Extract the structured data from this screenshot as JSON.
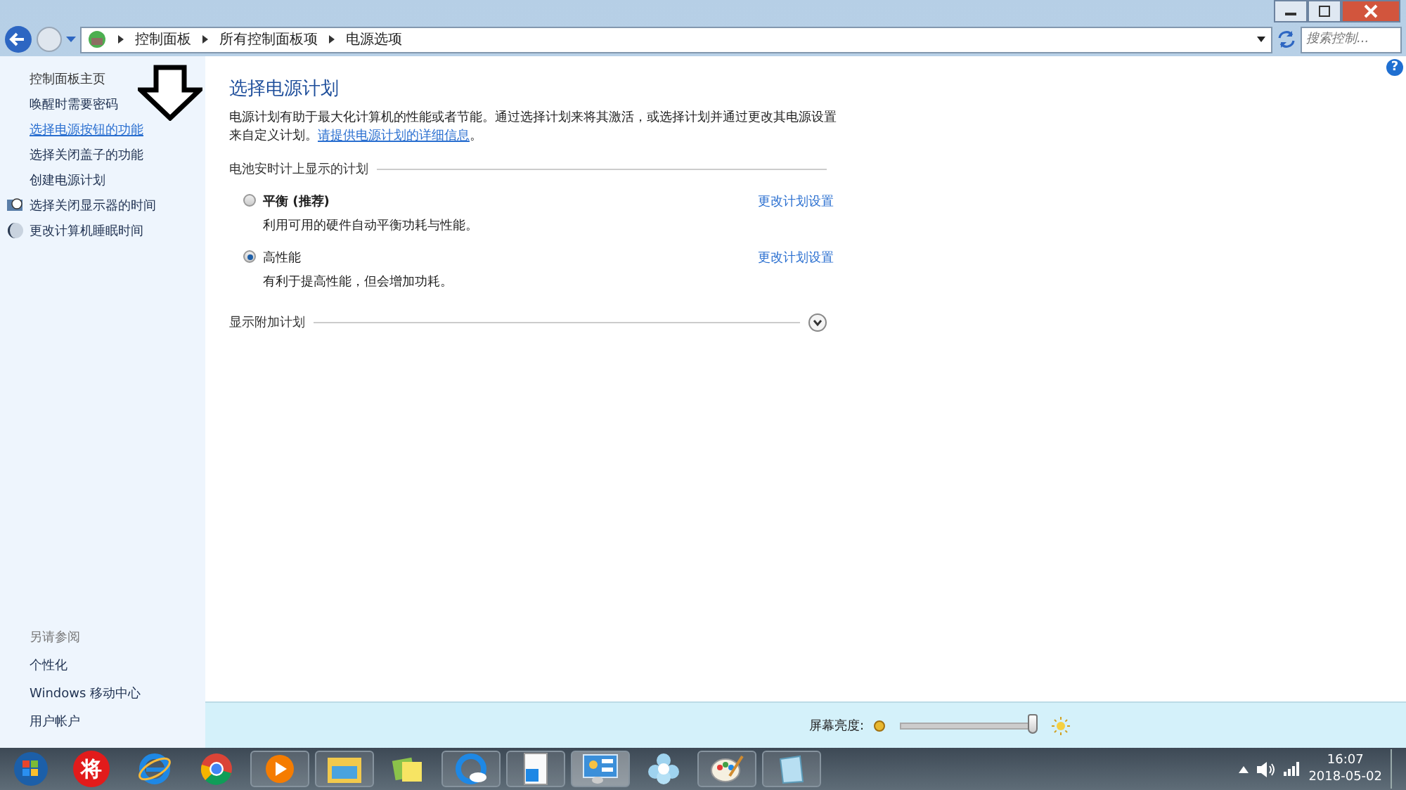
{
  "address_bar": {
    "crumbs": [
      "控制面板",
      "所有控制面板项",
      "电源选项"
    ]
  },
  "search": {
    "placeholder": "搜索控制..."
  },
  "help": "?",
  "sidebar": {
    "items": [
      {
        "label": "控制面板主页",
        "kind": "plain"
      },
      {
        "label": "唤醒时需要密码",
        "kind": "link"
      },
      {
        "label": "选择电源按钮的功能",
        "kind": "hover"
      },
      {
        "label": "选择关闭盖子的功能",
        "kind": "link"
      },
      {
        "label": "创建电源计划",
        "kind": "link"
      },
      {
        "label": "选择关闭显示器的时间",
        "kind": "monitor"
      },
      {
        "label": "更改计算机睡眠时间",
        "kind": "moon"
      }
    ],
    "see_also": {
      "title": "另请参阅",
      "items": [
        "个性化",
        "Windows 移动中心",
        "用户帐户"
      ]
    }
  },
  "main": {
    "title": "选择电源计划",
    "description": "电源计划有助于最大化计算机的性能或者节能。通过选择计划来将其激活，或选择计划并通过更改其电源设置来自定义计划。",
    "link": "请提供电源计划的详细信息",
    "after_link": "。",
    "group_title": "电池安时计上显示的计划",
    "plans": [
      {
        "name": "平衡",
        "note": "(推荐)",
        "description": "利用可用的硬件自动平衡功耗与性能。",
        "action": "更改计划设置",
        "selected": false
      },
      {
        "name": "高性能",
        "description": "有利于提高性能，但会增加功耗。",
        "action": "更改计划设置",
        "selected": true
      }
    ],
    "more_plans": {
      "label": "显示附加计划",
      "expanded": false
    }
  },
  "brightness": {
    "label": "屏幕亮度:",
    "level": 0.98
  },
  "taskbar": {
    "apps": [
      {
        "kind": "start"
      },
      {
        "kind": "red"
      },
      {
        "kind": "ie"
      },
      {
        "kind": "chrome"
      },
      {
        "kind": "media"
      },
      {
        "kind": "folder"
      },
      {
        "kind": "notes"
      },
      {
        "kind": "cloud"
      },
      {
        "kind": "doc"
      },
      {
        "kind": "panel"
      },
      {
        "kind": "flower"
      },
      {
        "kind": "paint"
      },
      {
        "kind": "notepad"
      }
    ],
    "red_label": "将",
    "time": "16:07",
    "date": "2018-05-02"
  }
}
